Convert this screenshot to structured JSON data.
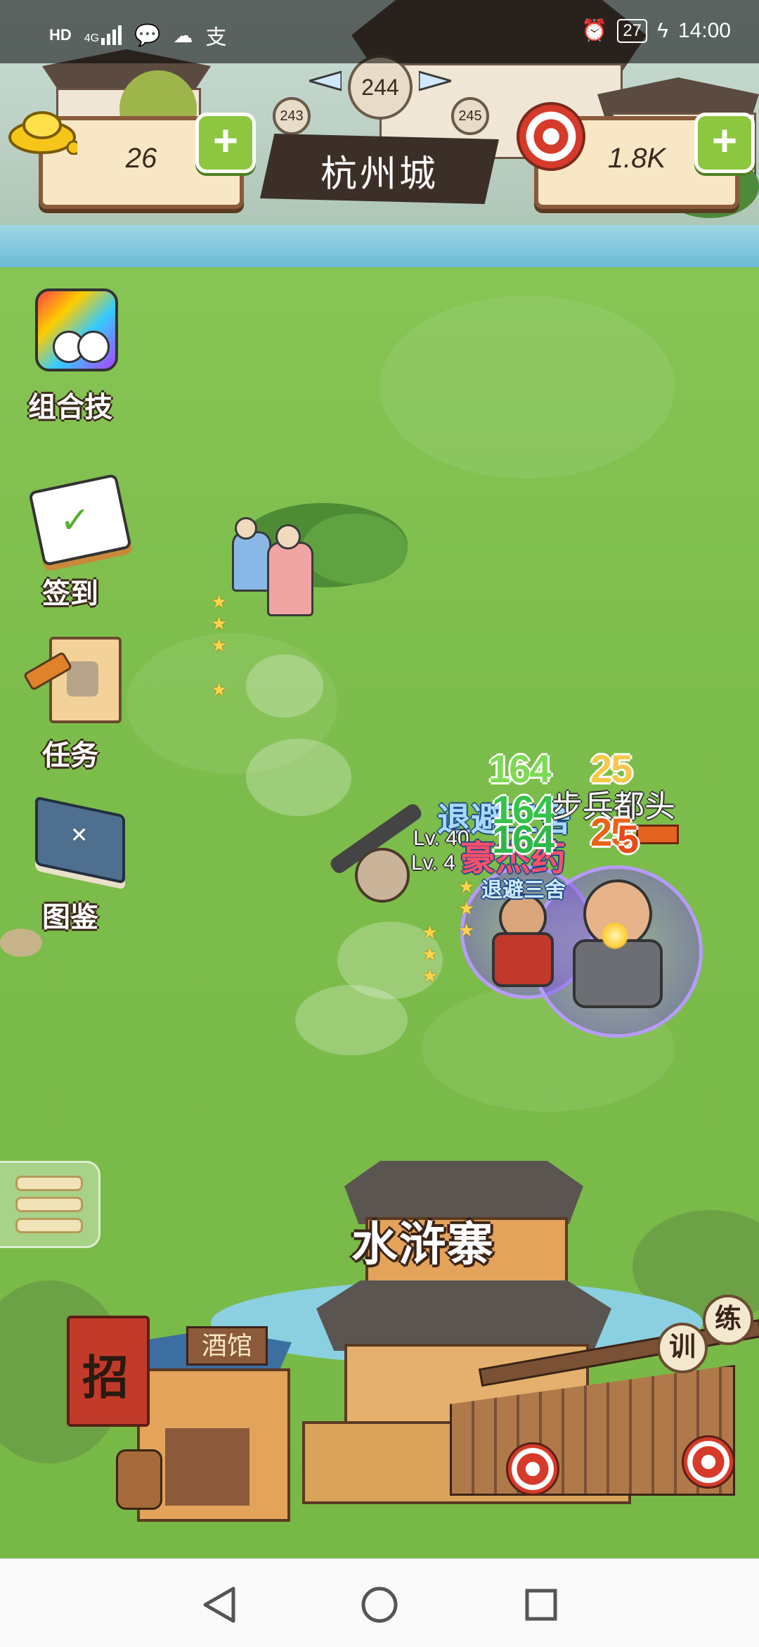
{
  "status_bar": {
    "left_icons": [
      "hd-icon",
      "4g-signal-icon",
      "wechat-icon",
      "cloud-icon",
      "alipay-icon"
    ],
    "hd": "HD",
    "network": "4G",
    "battery": "27",
    "time": "14:00"
  },
  "resources": {
    "gold": "26",
    "targets": "1.8K"
  },
  "location": {
    "city": "杭州城",
    "current_level": "244",
    "prev_level": "243",
    "next_level": "245"
  },
  "side_menu": [
    {
      "label": "组合技",
      "icon": "combo-skill-icon"
    },
    {
      "label": "签到",
      "icon": "checkin-calendar-icon"
    },
    {
      "label": "任务",
      "icon": "task-scroll-icon"
    },
    {
      "label": "图鉴",
      "icon": "codex-book-icon"
    }
  ],
  "battle": {
    "enemy_name": "步兵都头",
    "level_1": "Lv. 40",
    "level_2": "Lv. 4",
    "skill_text_1": "退避三舍",
    "skill_text_2": "豪杰药",
    "skill_tag": "退避三舍",
    "damage_numbers": [
      "164",
      "25",
      "164",
      "25",
      "164",
      "5"
    ]
  },
  "base": {
    "fortress": "水浒寨",
    "tavern_flag": "招",
    "tavern_sign": "酒馆",
    "training_sign_1": "训",
    "training_sign_2": "练"
  },
  "colors": {
    "grass": "#7dbd4b",
    "plus_green": "#8dc63f",
    "wood": "#8a5a3a"
  }
}
